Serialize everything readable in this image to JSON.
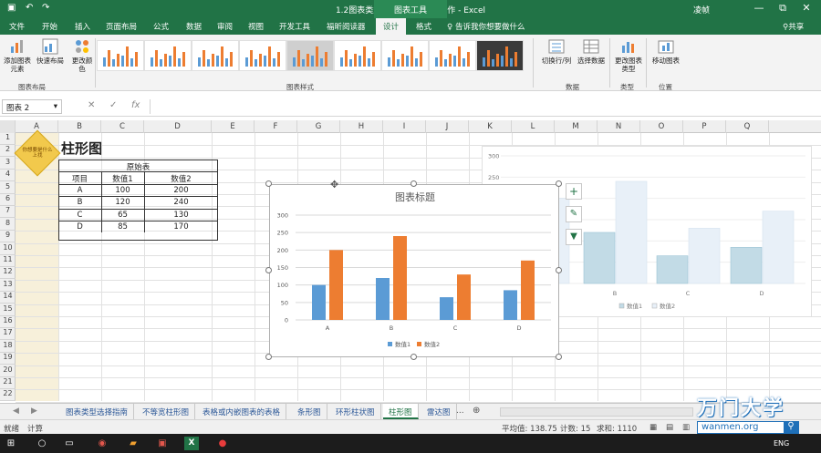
{
  "titlebar": {
    "title": "1.2图表类型选择指南 - 图表制作 - Excel",
    "tools_tab": "图表工具",
    "user": "凌帧",
    "save_icon": "save-icon",
    "undo_icon": "undo-icon",
    "redo_icon": "redo-icon",
    "minimize": "—",
    "restore": "⧉",
    "close": "✕"
  },
  "tabs": {
    "items": [
      "文件",
      "开始",
      "插入",
      "页面布局",
      "公式",
      "数据",
      "审阅",
      "视图",
      "开发工具",
      "福昕阅读器",
      "设计",
      "格式"
    ],
    "active": "设计",
    "tellme": "告诉我你想要做什么",
    "share": "共享"
  },
  "ribbon": {
    "add_chart_element": "添加图表元素",
    "quick_layout": "快速布局",
    "change_colors": "更改颜色",
    "group_layouts": "图表布局",
    "group_styles": "图表样式",
    "switch_row_col": "切换行/列",
    "select_data": "选择数据",
    "group_data": "数据",
    "change_type": "更改图表类型",
    "group_type": "类型",
    "move_chart": "移动图表",
    "group_location": "位置"
  },
  "formula_bar": {
    "name_box": "图表 2",
    "cancel": "✕",
    "enter": "✓",
    "fx": "fx",
    "value": ""
  },
  "columns": [
    "A",
    "B",
    "C",
    "D",
    "E",
    "F",
    "G",
    "H",
    "I",
    "J",
    "K",
    "L",
    "M",
    "N",
    "O",
    "P",
    "Q"
  ],
  "rows": [
    "1",
    "2",
    "3",
    "4",
    "5",
    "6",
    "7",
    "8",
    "9",
    "10",
    "11",
    "12",
    "13",
    "14",
    "15",
    "16",
    "17",
    "18",
    "19",
    "20",
    "21",
    "22"
  ],
  "sheet": {
    "logo_text": "你想要是什么\n上找",
    "heading": "柱形图",
    "table_title": "原始表",
    "table_headers": [
      "项目",
      "数值1",
      "数值2"
    ],
    "table_rows": [
      [
        "A",
        "100",
        "200"
      ],
      [
        "B",
        "120",
        "240"
      ],
      [
        "C",
        "65",
        "130"
      ],
      [
        "D",
        "85",
        "170"
      ]
    ]
  },
  "chart_data": [
    {
      "type": "bar",
      "title": "图表标题",
      "categories": [
        "A",
        "B",
        "C",
        "D"
      ],
      "series": [
        {
          "name": "数值1",
          "values": [
            100,
            120,
            65,
            85
          ]
        },
        {
          "name": "数值2",
          "values": [
            200,
            240,
            130,
            170
          ]
        }
      ],
      "ylim": [
        0,
        300
      ],
      "yticks": [
        "0",
        "50",
        "100",
        "150",
        "200",
        "250",
        "300"
      ],
      "colors": [
        "#5b9bd5",
        "#ed7d31"
      ],
      "legend": "bottom",
      "grid": true
    },
    {
      "type": "bar",
      "categories": [
        "A",
        "B",
        "C",
        "D"
      ],
      "series": [
        {
          "name": "数值1",
          "values": [
            100,
            120,
            65,
            85
          ]
        },
        {
          "name": "数值2",
          "values": [
            200,
            240,
            130,
            170
          ]
        }
      ],
      "ylim": [
        0,
        300
      ],
      "yticks_visible": [
        "250",
        "300"
      ],
      "xticks_visible": [
        "B",
        "C",
        "D"
      ],
      "colors": [
        "#c2dbe6",
        "#e8f0f8"
      ],
      "legend": "bottom",
      "grid": true
    }
  ],
  "chart_side_buttons": [
    "plus-icon",
    "brush-icon",
    "filter-icon"
  ],
  "sheet_tabs": {
    "items": [
      "图表类型选择指南",
      "不等宽柱形图",
      "表格或内嵌图表的表格",
      "条形图",
      "环形柱状图",
      "柱形图",
      "雷达图"
    ],
    "active": "柱形图",
    "more": "...",
    "add": "⊕"
  },
  "status": {
    "mode": "就绪",
    "calc": "计算",
    "average": "平均值: 138.75",
    "count": "计数: 15",
    "sum": "求和: 1110"
  },
  "watermark": {
    "brand": "万门大学",
    "url": "wanmen.org"
  },
  "taskbar": {
    "lang": "ENG"
  }
}
